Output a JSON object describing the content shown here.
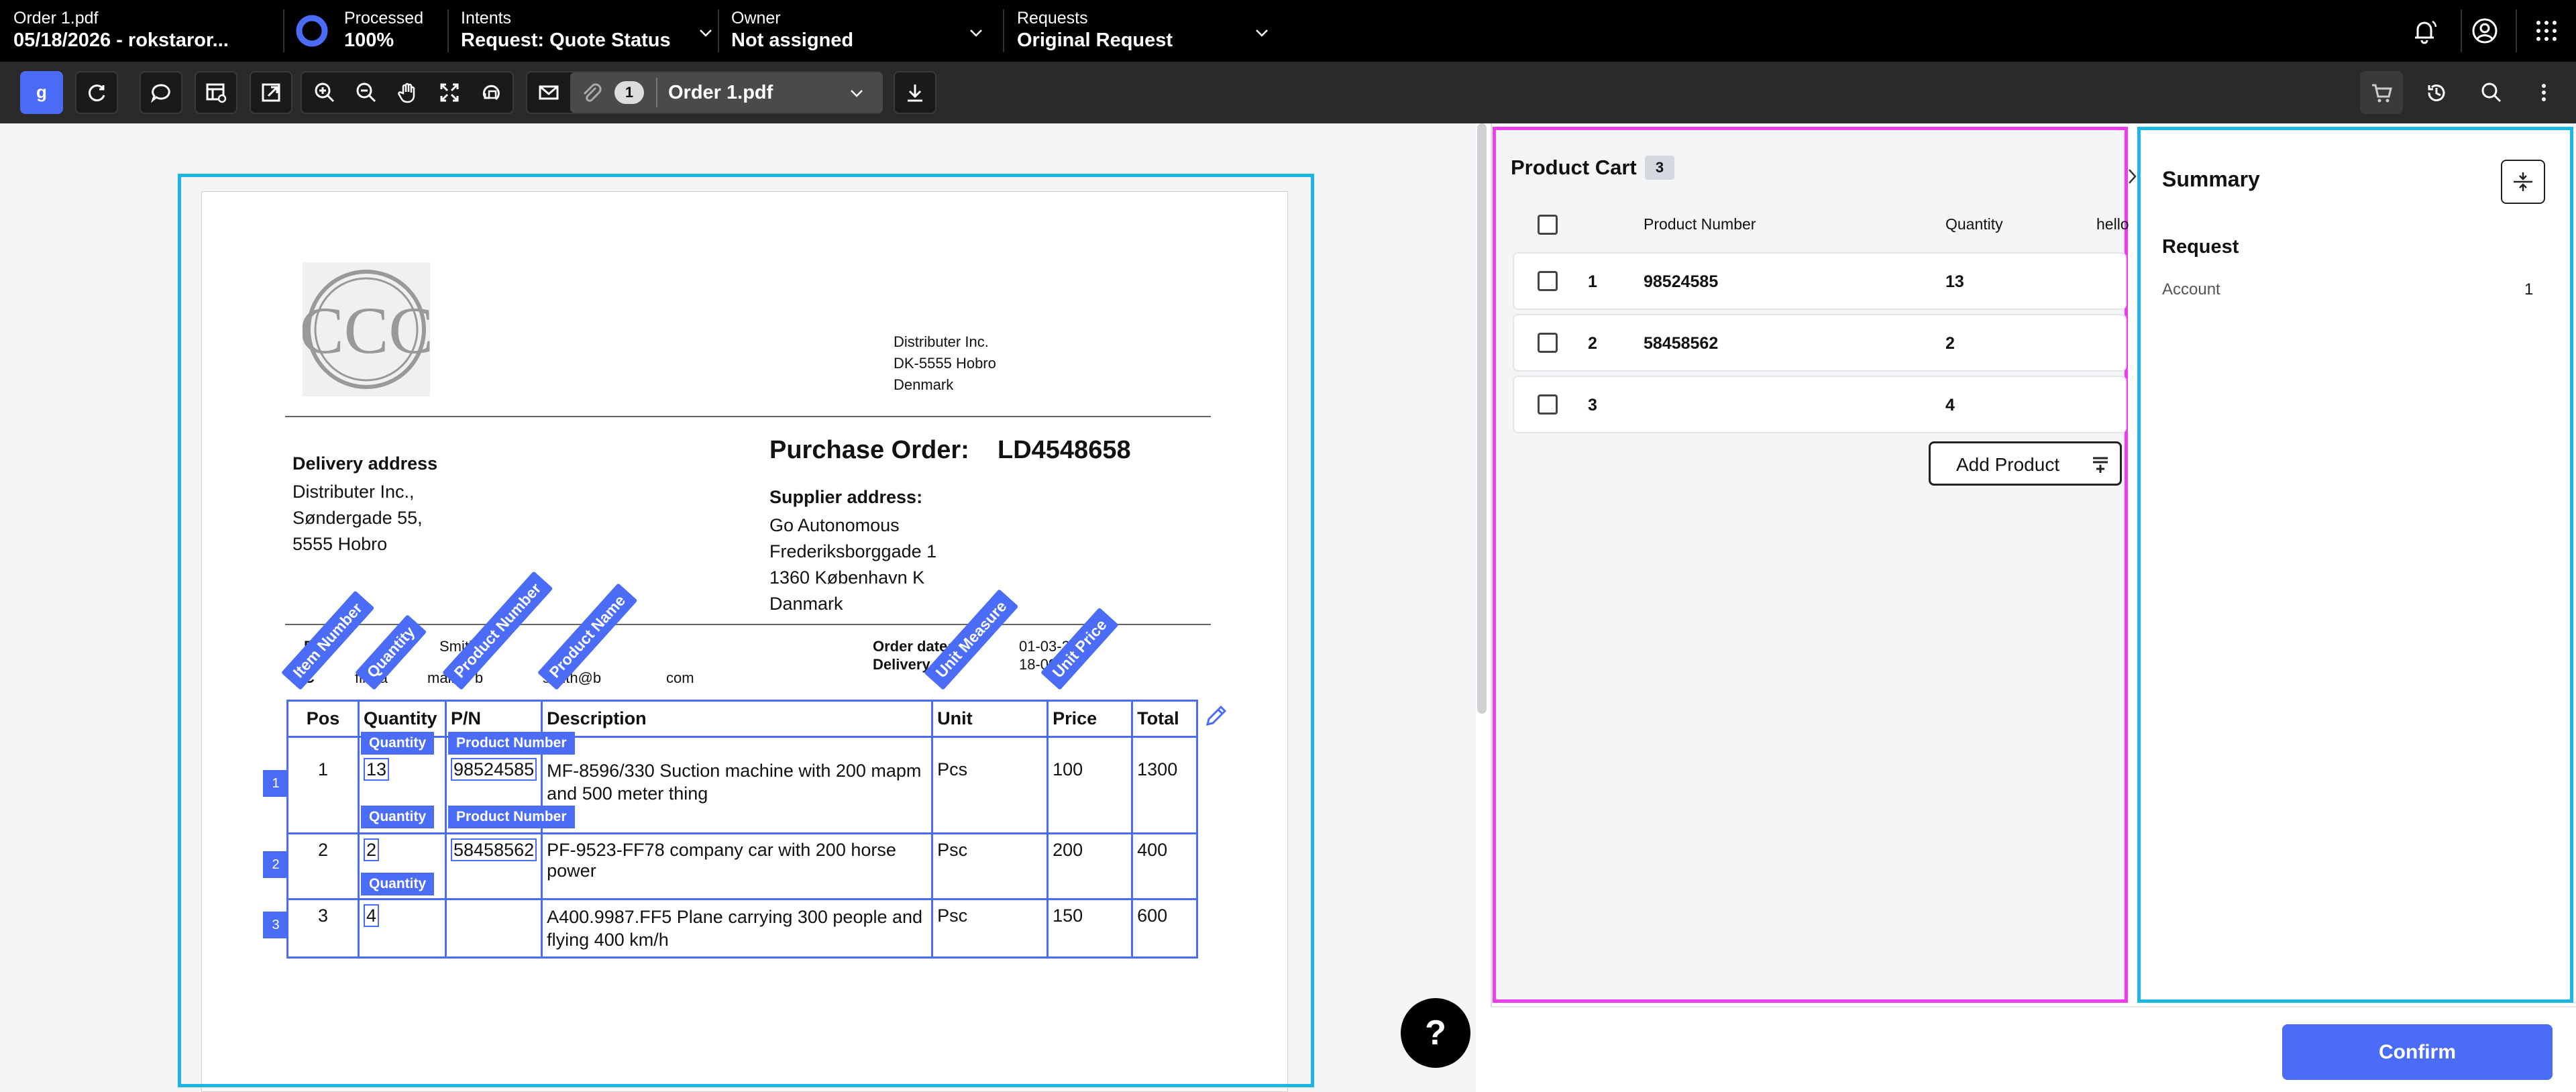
{
  "header": {
    "file_name": "Order 1.pdf",
    "file_sub": "05/18/2026 - rokstaror...",
    "processed_label": "Processed",
    "processed_value": "100%",
    "intents_label": "Intents",
    "intents_value": "Request: Quote Status",
    "owner_label": "Owner",
    "owner_value": "Not assigned",
    "requests_label": "Requests",
    "requests_value": "Original Request"
  },
  "toolbar": {
    "attachment_count": "1",
    "doc_select": "Order 1.pdf",
    "icons": [
      "logo-g-icon",
      "refresh-icon",
      "comment-icon",
      "table-settings-icon",
      "export-icon",
      "zoom-in-icon",
      "zoom-out-icon",
      "hand-icon",
      "fit-icon",
      "rotate-icon",
      "mail-icon",
      "paperclip-icon",
      "download-icon",
      "cart-icon",
      "history-icon",
      "search-icon",
      "more-vertical-icon"
    ]
  },
  "document": {
    "seller": [
      "Distributer Inc.",
      "DK-5555 Hobro",
      "Denmark"
    ],
    "delivery_title": "Delivery address",
    "delivery_lines": [
      "Distributer Inc.,",
      "Søndergade 55,",
      "5555 Hobro"
    ],
    "po_label": "Purchase Order:",
    "po_number": "LD4548658",
    "supplier_title": "Supplier address:",
    "supplier_lines": [
      "Go Autonomous",
      "Frederiksborggade 1",
      "1360 København K",
      "Danmark"
    ],
    "purchaser_label": "Pur",
    "purchaser_value": "Smith",
    "confirm_label": "C",
    "confirm_mid": "firma",
    "confirm_mail": "mail to b",
    "confirm_tail": "smith@b",
    "confirm_end": "com",
    "order_date_label": "Order date:",
    "order_date_value": "01-03-20",
    "delivery_date_label": "Delivery d",
    "delivery_date_value": "18-09-",
    "annotations": [
      "Item Number",
      "Quantity",
      "Product Number",
      "Product Name",
      "Unit Measure",
      "Unit Price"
    ],
    "tag_quantity": "Quantity",
    "tag_product_number": "Product Number",
    "table": {
      "headers": [
        "Pos",
        "Quantity",
        "P/N",
        "Description",
        "Unit",
        "Price",
        "Total"
      ],
      "rows": [
        {
          "pos": "1",
          "qty": "13",
          "pn": "98524585",
          "desc1": "MF-8596/330 Suction machine with 200 mapm",
          "desc2": "and 500 meter thing",
          "unit": "Pcs",
          "price": "100",
          "total": "1300"
        },
        {
          "pos": "2",
          "qty": "2",
          "pn": "58458562",
          "desc1": "PF-9523-FF78 company car with 200 horse power",
          "desc2": "",
          "unit": "Psc",
          "price": "200",
          "total": "400"
        },
        {
          "pos": "3",
          "qty": "4",
          "pn": "",
          "desc1": "A400.9987.FF5 Plane carrying 300 people and",
          "desc2": "flying 400 km/h",
          "unit": "Psc",
          "price": "150",
          "total": "600"
        }
      ]
    },
    "row_markers": [
      "1",
      "2",
      "3"
    ],
    "help": "?"
  },
  "cart": {
    "title": "Product Cart",
    "count": "3",
    "col_product_number": "Product Number",
    "col_quantity": "Quantity",
    "col_extra": "hello",
    "rows": [
      {
        "index": "1",
        "product_number": "98524585",
        "quantity": "13"
      },
      {
        "index": "2",
        "product_number": "58458562",
        "quantity": "2"
      },
      {
        "index": "3",
        "product_number": "",
        "quantity": "4"
      }
    ],
    "add_product": "Add Product"
  },
  "summary": {
    "title": "Summary",
    "section": "Request",
    "account_label": "Account",
    "account_value": "1"
  },
  "confirm": "Confirm",
  "colors": {
    "accent": "#4a6cf7",
    "cart_outline": "#f03cf0",
    "doc_outline": "#1bb6e3"
  }
}
